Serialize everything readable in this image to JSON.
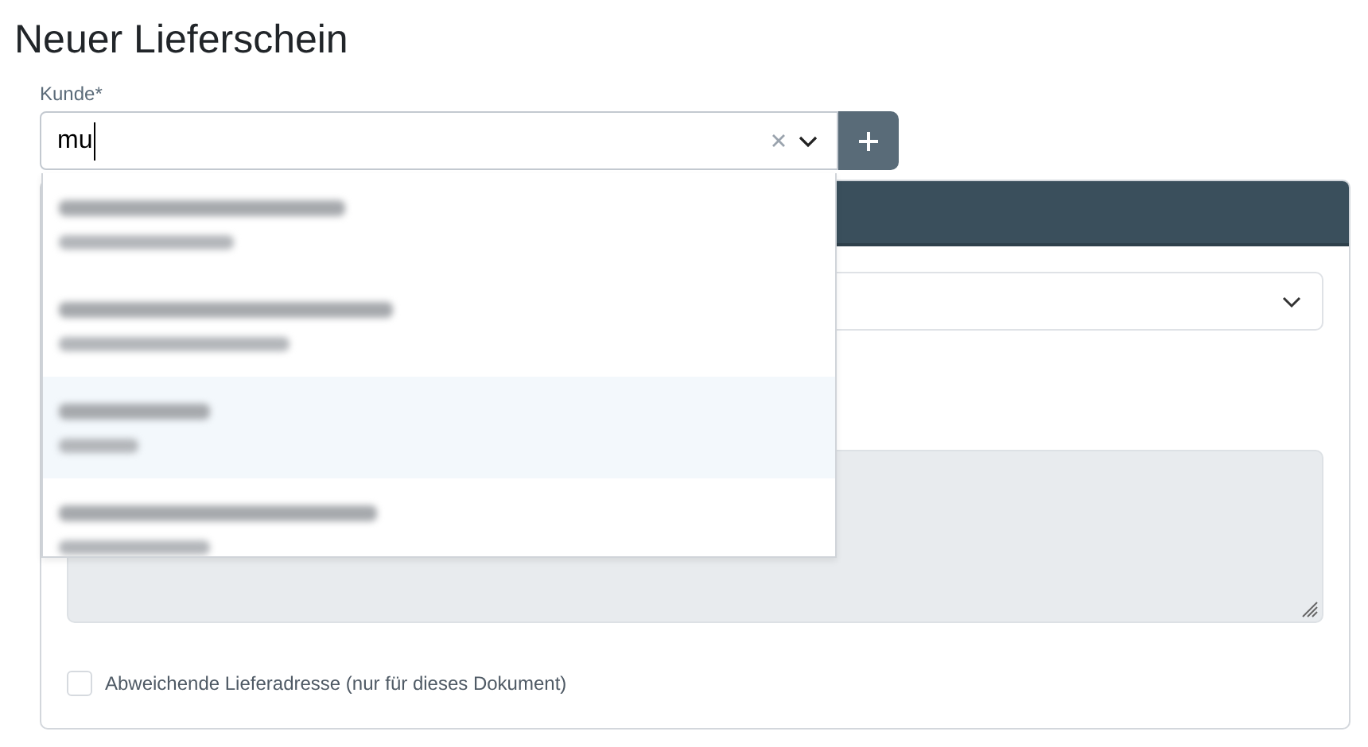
{
  "page": {
    "title": "Neuer Lieferschein"
  },
  "customer_field": {
    "label": "Kunde*",
    "value": "mu"
  },
  "dropdown": {
    "options": [
      {
        "selected": false
      },
      {
        "selected": false
      },
      {
        "selected": true
      },
      {
        "selected": false
      }
    ]
  },
  "card": {
    "checkbox": {
      "label": "Abweichende Lieferadresse (nur für dieses Dokument)",
      "checked": false
    }
  }
}
